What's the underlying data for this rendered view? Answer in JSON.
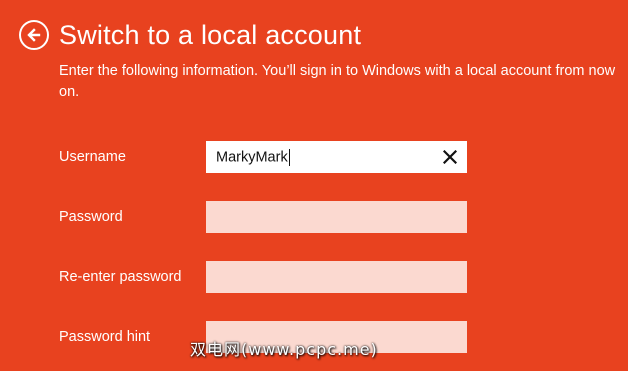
{
  "header": {
    "back_icon": "back-arrow-icon",
    "title": "Switch to a local account"
  },
  "subtitle": "Enter the following information. You’ll sign in to Windows with a local account from now on.",
  "form": {
    "username": {
      "label": "Username",
      "value": "MarkyMark",
      "clear_icon": "close-icon"
    },
    "password": {
      "label": "Password",
      "value": ""
    },
    "reenter_password": {
      "label": "Re-enter password",
      "value": ""
    },
    "password_hint": {
      "label": "Password hint",
      "value": ""
    }
  },
  "watermark": "双电网(www.pcpc.me)",
  "colors": {
    "background": "#E8421F",
    "field_empty": "#FBD9D0",
    "field_active": "#FFFFFF",
    "text": "#FFFFFF"
  }
}
